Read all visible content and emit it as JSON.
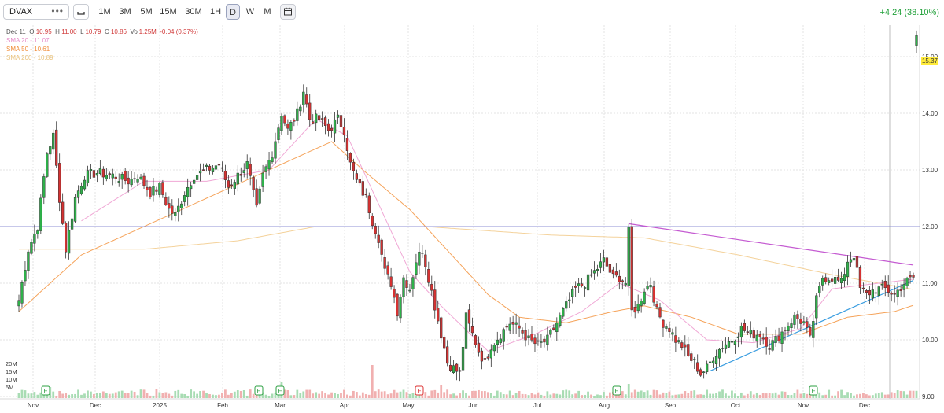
{
  "toolbar": {
    "symbol": "DVAX",
    "menu_icon": "ellipsis-icon",
    "chart_type_icon": "candlestick-icon",
    "intervals": [
      "1M",
      "3M",
      "5M",
      "15M",
      "30M",
      "1H",
      "D",
      "W",
      "M"
    ],
    "active_interval": "D",
    "calendar_icon": "calendar-icon",
    "change_text": "+4.24 (38.10%)"
  },
  "legend": {
    "date": "Dec 11",
    "open_label": "O",
    "open": "10.95",
    "high_label": "H",
    "high": "11.00",
    "low_label": "L",
    "low": "10.79",
    "close_label": "C",
    "close": "10.86",
    "vol_label": "Vol",
    "vol": "1.25M",
    "change": "-0.04 (0.37%)",
    "sma20": "SMA 20 - 11.07",
    "sma50": "SMA 50 - 10.61",
    "sma200": "SMA 200 - 10.89"
  },
  "price_badge": "15.37",
  "colors": {
    "up": "#2eb14a",
    "down": "#d63232",
    "sma20": "#f0a7d5",
    "sma50": "#f5a35a",
    "sma200": "#f4d29b",
    "hline": "#8f90d6",
    "trend_upper": "#c45ad1",
    "trend_lower": "#3a9de0",
    "legend_red": "#d03a3a",
    "change_green": "#1e9f37"
  },
  "chart_data": {
    "type": "candlestick",
    "ylim": [
      9.0,
      15.5
    ],
    "y_ticks": [
      "15.00",
      "14.00",
      "13.00",
      "12.00",
      "11.00",
      "10.00",
      "9.00"
    ],
    "x_ticks": [
      "Nov",
      "Dec",
      "2025",
      "Feb",
      "Mar",
      "Apr",
      "May",
      "Jun",
      "Jul",
      "Aug",
      "Sep",
      "Oct",
      "Nov",
      "Dec"
    ],
    "volume_ticks": [
      "20M",
      "15M",
      "10M",
      "5M"
    ],
    "horizontal_level": 12.0,
    "earnings_markers": [
      {
        "label": "E",
        "date": "Nov",
        "type": "beat"
      },
      {
        "label": "E",
        "date": "Feb",
        "type": "beat"
      },
      {
        "label": "E",
        "date": "Mar",
        "type": "beat"
      },
      {
        "label": "E",
        "date": "May",
        "type": "miss"
      },
      {
        "label": "E",
        "date": "Aug",
        "type": "beat"
      },
      {
        "label": "E",
        "date": "Nov",
        "type": "beat"
      }
    ],
    "close_anchors": [
      [
        0,
        10.7
      ],
      [
        3,
        11.6
      ],
      [
        6,
        12.0
      ],
      [
        9,
        13.3
      ],
      [
        11,
        13.6
      ],
      [
        13,
        12.5
      ],
      [
        15,
        11.6
      ],
      [
        18,
        12.5
      ],
      [
        21,
        12.9
      ],
      [
        25,
        12.95
      ],
      [
        30,
        12.9
      ],
      [
        35,
        12.8
      ],
      [
        38,
        12.9
      ],
      [
        42,
        12.6
      ],
      [
        45,
        12.7
      ],
      [
        48,
        12.3
      ],
      [
        50,
        12.2
      ],
      [
        53,
        12.6
      ],
      [
        56,
        12.9
      ],
      [
        60,
        13.0
      ],
      [
        64,
        13.1
      ],
      [
        67,
        12.7
      ],
      [
        70,
        12.9
      ],
      [
        73,
        13.1
      ],
      [
        76,
        12.3
      ],
      [
        78,
        12.9
      ],
      [
        81,
        13.3
      ],
      [
        84,
        14.0
      ],
      [
        86,
        13.7
      ],
      [
        89,
        14.0
      ],
      [
        91,
        14.4
      ],
      [
        93,
        13.9
      ],
      [
        96,
        13.9
      ],
      [
        99,
        13.7
      ],
      [
        102,
        13.9
      ],
      [
        104,
        13.7
      ],
      [
        106,
        13.1
      ],
      [
        108,
        12.8
      ],
      [
        111,
        12.5
      ],
      [
        113,
        12.1
      ],
      [
        115,
        11.8
      ],
      [
        117,
        11.2
      ],
      [
        119,
        11.0
      ],
      [
        121,
        10.5
      ],
      [
        123,
        11.1
      ],
      [
        125,
        10.9
      ],
      [
        127,
        11.4
      ],
      [
        129,
        11.6
      ],
      [
        131,
        11.1
      ],
      [
        133,
        10.6
      ],
      [
        135,
        10.1
      ],
      [
        137,
        9.6
      ],
      [
        139,
        9.5
      ],
      [
        141,
        9.4
      ],
      [
        143,
        10.4
      ],
      [
        145,
        10.1
      ],
      [
        147,
        9.8
      ],
      [
        149,
        9.6
      ],
      [
        151,
        9.9
      ],
      [
        154,
        10.1
      ],
      [
        157,
        10.3
      ],
      [
        160,
        10.2
      ],
      [
        163,
        10.0
      ],
      [
        166,
        9.9
      ],
      [
        169,
        10.0
      ],
      [
        172,
        10.3
      ],
      [
        175,
        10.6
      ],
      [
        178,
        10.9
      ],
      [
        181,
        11.0
      ],
      [
        184,
        11.2
      ],
      [
        187,
        11.4
      ],
      [
        190,
        11.1
      ],
      [
        192,
        11.1
      ],
      [
        194,
        11.0
      ],
      [
        195,
        11.9
      ],
      [
        196,
        10.5
      ],
      [
        198,
        10.6
      ],
      [
        200,
        10.9
      ],
      [
        202,
        11.0
      ],
      [
        204,
        10.5
      ],
      [
        206,
        10.3
      ],
      [
        208,
        10.2
      ],
      [
        210,
        10.0
      ],
      [
        212,
        9.9
      ],
      [
        214,
        9.7
      ],
      [
        216,
        9.6
      ],
      [
        218,
        9.4
      ],
      [
        220,
        9.5
      ],
      [
        222,
        9.7
      ],
      [
        225,
        9.9
      ],
      [
        228,
        10.0
      ],
      [
        231,
        10.2
      ],
      [
        234,
        10.1
      ],
      [
        237,
        10.1
      ],
      [
        240,
        9.9
      ],
      [
        242,
        10.0
      ],
      [
        245,
        10.2
      ],
      [
        248,
        10.4
      ],
      [
        251,
        10.3
      ],
      [
        253,
        10.0
      ],
      [
        255,
        10.7
      ],
      [
        257,
        11.1
      ],
      [
        260,
        11.1
      ],
      [
        263,
        11.0
      ],
      [
        265,
        11.4
      ],
      [
        267,
        11.5
      ],
      [
        269,
        10.9
      ],
      [
        271,
        10.8
      ],
      [
        274,
        10.9
      ],
      [
        277,
        10.9
      ],
      [
        280,
        10.8
      ],
      [
        283,
        11.0
      ],
      [
        286,
        11.1
      ],
      [
        287,
        15.37
      ]
    ],
    "sma20_anchors": [
      [
        20,
        12.1
      ],
      [
        40,
        12.8
      ],
      [
        60,
        12.8
      ],
      [
        80,
        13.0
      ],
      [
        95,
        13.9
      ],
      [
        105,
        13.6
      ],
      [
        115,
        12.4
      ],
      [
        125,
        11.2
      ],
      [
        135,
        10.6
      ],
      [
        150,
        9.8
      ],
      [
        165,
        10.1
      ],
      [
        180,
        10.5
      ],
      [
        192,
        11.0
      ],
      [
        205,
        10.7
      ],
      [
        220,
        10.0
      ],
      [
        235,
        9.95
      ],
      [
        250,
        10.2
      ],
      [
        260,
        10.9
      ],
      [
        275,
        11.0
      ],
      [
        286,
        11.07
      ]
    ],
    "sma50_anchors": [
      [
        0,
        10.5
      ],
      [
        20,
        11.5
      ],
      [
        40,
        12.0
      ],
      [
        60,
        12.5
      ],
      [
        80,
        13.0
      ],
      [
        100,
        13.5
      ],
      [
        110,
        13.0
      ],
      [
        125,
        12.3
      ],
      [
        135,
        11.7
      ],
      [
        150,
        10.8
      ],
      [
        160,
        10.4
      ],
      [
        175,
        10.3
      ],
      [
        190,
        10.5
      ],
      [
        200,
        10.6
      ],
      [
        215,
        10.4
      ],
      [
        230,
        10.1
      ],
      [
        250,
        10.1
      ],
      [
        265,
        10.4
      ],
      [
        280,
        10.5
      ],
      [
        286,
        10.61
      ]
    ],
    "sma200_anchors": [
      [
        0,
        11.6
      ],
      [
        40,
        11.6
      ],
      [
        70,
        11.75
      ],
      [
        95,
        12.0
      ],
      [
        130,
        12.0
      ],
      [
        170,
        11.85
      ],
      [
        200,
        11.8
      ],
      [
        230,
        11.5
      ],
      [
        260,
        11.15
      ],
      [
        286,
        10.89
      ]
    ],
    "trendline_upper": [
      [
        195,
        12.05
      ],
      [
        286,
        11.32
      ]
    ],
    "trendline_lower": [
      [
        221,
        9.45
      ],
      [
        286,
        11.05
      ]
    ],
    "n_bars": 288
  }
}
